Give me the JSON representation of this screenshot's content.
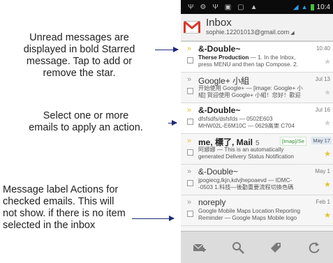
{
  "annotations": {
    "unread": "Unread messages are\ndisplayed in bold Starred\nmessage. Tap to add or\nremove the star.",
    "select": "Select one or more\nemails to apply an action.",
    "label": "Message label Actions for\nchecked emails. This will\nnot show. if there is no item\nselected in the inbox"
  },
  "status_bar": {
    "time": "10:4"
  },
  "header": {
    "title": "Inbox",
    "account": "sophie.12201013@gmail.com"
  },
  "emails": [
    {
      "sender": "&-Double~",
      "date": "10:40",
      "subject": "Therse Production",
      "line1_rest": " — 1. In the Inbox,",
      "line2": "press MENU and then tap Compose. 2.",
      "unread": true,
      "starred": false
    },
    {
      "sender": "Google+ 小組",
      "date": "Jul 13",
      "subject": "",
      "line1_rest": "开始使用 Google+ — [image: Google+ 小",
      "line2": "組] 賀迎使用 Google+ 小組！您好！歡迎",
      "unread": false,
      "starred": false
    },
    {
      "sender": "&-Double~",
      "date": "Jul 16",
      "subject": "",
      "line1_rest": "dfsfsdfs/dsfsfds — 0502E603",
      "line2": "MHW02L-E6M10C — 0629高樂 C704",
      "unread": true,
      "starred": false
    },
    {
      "sender": "me, 標了, Mail",
      "count": "5",
      "date": "May 17",
      "label": "[Imap]/Se",
      "subject": "",
      "line1_rest": "阿娜娜 — This is an automatically",
      "line2": "generated Delivery Status Notification",
      "unread": false,
      "starred": true
    },
    {
      "sender": "&-Double~",
      "date": "May 1",
      "subject": "",
      "line1_rest": "jpogiecg,lkjn,kdvjhepoaevd — IDMC-",
      "line2": "-0503 1.科技—後勤重要流程切換色碼",
      "unread": false,
      "starred": true
    },
    {
      "sender": "noreply",
      "date": "Feb 1",
      "subject": "",
      "line1_rest": "Google Mobile Maps Location Reporting",
      "line2": "Reminder — Google Maps Mobile logo",
      "unread": false,
      "starred": true
    }
  ],
  "icons": {
    "compose": "compose-icon",
    "search": "search-icon",
    "labels": "label-icon",
    "refresh": "refresh-icon"
  },
  "colors": {
    "star": "#e3c42c",
    "wifi": "#2d9be8",
    "gmail_red": "#d8372b"
  }
}
